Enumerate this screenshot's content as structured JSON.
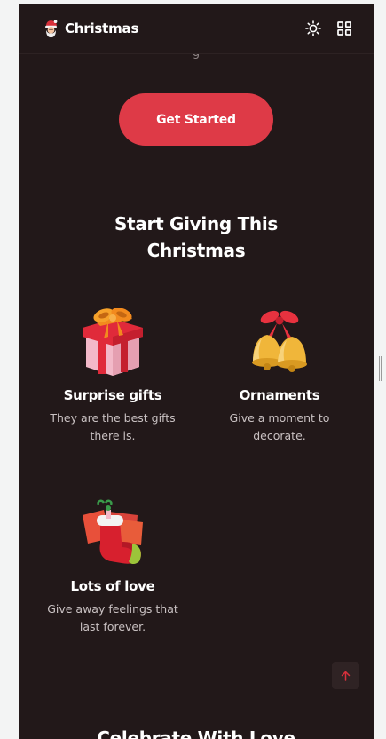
{
  "header": {
    "brand": "Christmas",
    "logo_icon": "santa-icon",
    "theme_toggle_icon": "sun-icon",
    "menu_icon": "grid-icon"
  },
  "hero": {
    "cut_text": "g",
    "cta_label": "Get Started"
  },
  "giving": {
    "title": "Start Giving This Christmas",
    "cards": [
      {
        "icon": "gift-box-icon",
        "title": "Surprise gifts",
        "desc": "They are the best gifts there is."
      },
      {
        "icon": "bells-icon",
        "title": "Ornaments",
        "desc": "Give a moment to decorate."
      },
      {
        "icon": "stocking-icon",
        "title": "Lots of love",
        "desc": "Give away feelings that last forever."
      }
    ]
  },
  "next_section": {
    "title": "Celebrate With Love"
  },
  "scroll_top_icon": "arrow-up-icon",
  "colors": {
    "background": "#221819",
    "accent": "#de3a47",
    "text": "#ffffff",
    "muted": "#c9c1c2"
  }
}
